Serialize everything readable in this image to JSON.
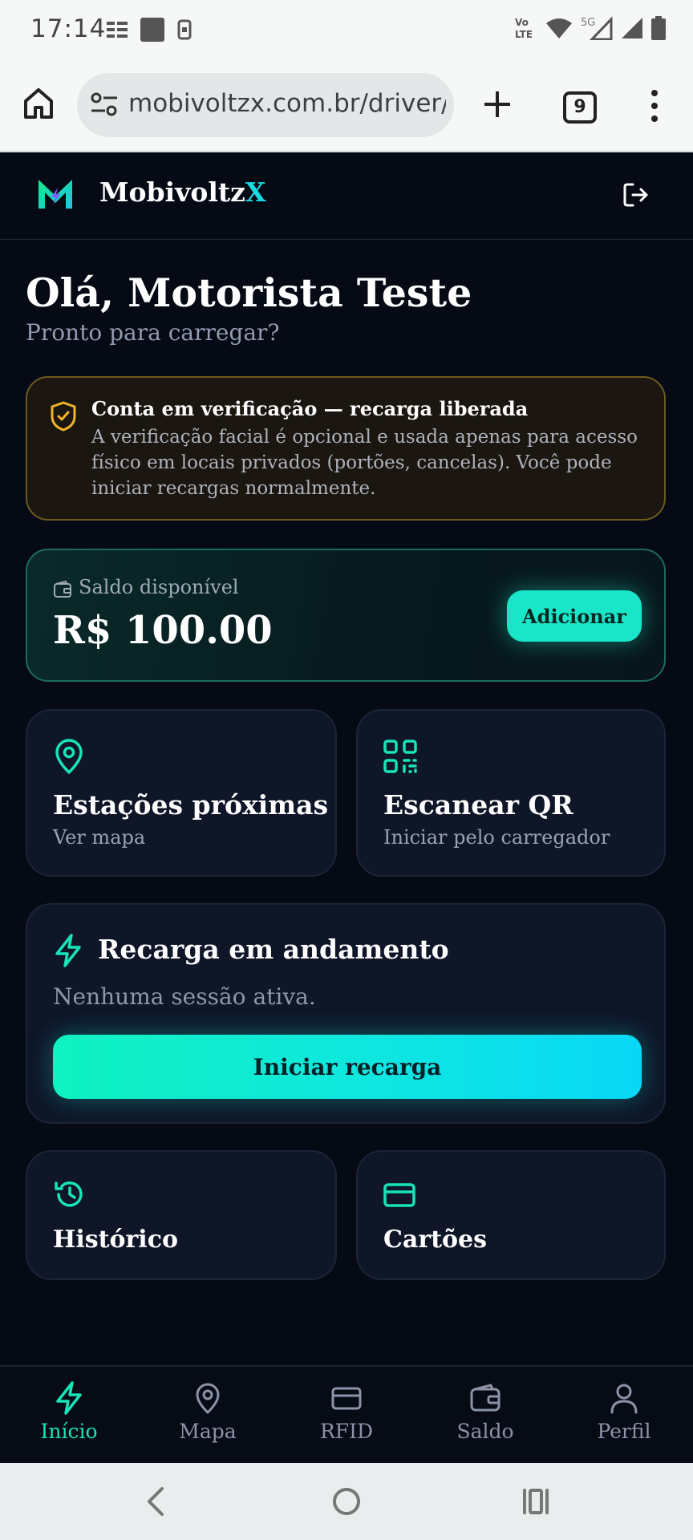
{
  "status_bar": {
    "time": "17:14",
    "left_icons": [
      "notification-list-icon",
      "image-thumb-icon",
      "phone-device-icon"
    ],
    "right_icons": [
      "volte-icon",
      "wifi-icon",
      "5g-icon",
      "signal-icon",
      "signal-icon",
      "battery-icon"
    ],
    "volte_label_1": "Vo",
    "volte_label_2": "LTE",
    "network_label": "5G"
  },
  "browser": {
    "url": "mobivoltzx.com.br/driver/dashboard",
    "tab_count": "9"
  },
  "header": {
    "brand_main": "Mobivoltz",
    "brand_accent": "X",
    "accent_color": "#19dbe0"
  },
  "greeting": {
    "title": "Olá, Motorista Teste",
    "subtitle": "Pronto para carregar?"
  },
  "verification": {
    "title": "Conta em verificação — recarga liberada",
    "text": "A verificação facial é opcional e usada apenas para acesso físico em locais privados (portões, cancelas). Você pode iniciar recargas normalmente.",
    "color": "#f0b429"
  },
  "balance": {
    "label": "Saldo disponível",
    "value": "R$ 100.00",
    "button": "Adicionar"
  },
  "quick_actions": [
    {
      "title": "Estações próximas",
      "subtitle": "Ver mapa",
      "icon": "map-pin-icon"
    },
    {
      "title": "Escanear QR",
      "subtitle": "Iniciar pelo carregador",
      "icon": "qr-code-icon"
    }
  ],
  "charging": {
    "title": "Recarga em andamento",
    "empty_text": "Nenhuma sessão ativa.",
    "button": "Iniciar recarga"
  },
  "shortcuts": [
    {
      "title": "Histórico",
      "icon": "history-icon"
    },
    {
      "title": "Cartões",
      "icon": "credit-card-icon"
    }
  ],
  "bottom_nav": [
    {
      "label": "Início",
      "icon": "bolt-icon",
      "active": true
    },
    {
      "label": "Mapa",
      "icon": "map-pin-icon",
      "active": false
    },
    {
      "label": "RFID",
      "icon": "card-icon",
      "active": false
    },
    {
      "label": "Saldo",
      "icon": "wallet-icon",
      "active": false
    },
    {
      "label": "Perfil",
      "icon": "user-icon",
      "active": false
    }
  ],
  "colors": {
    "background": "#050a15",
    "card": "#0e1628",
    "accent": "#19e3b8"
  }
}
